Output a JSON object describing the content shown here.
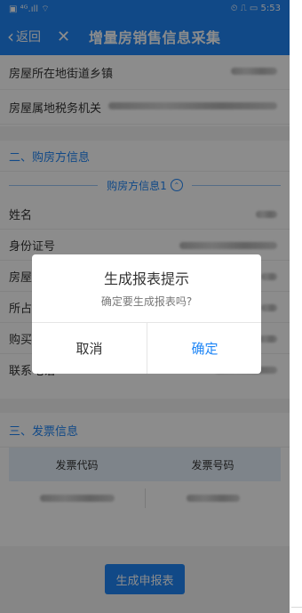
{
  "status_bar": {
    "left": "▣ ⁴ᴳ.ıll ⌔",
    "right": "⏲ ⎍ ▭ 5:53"
  },
  "nav": {
    "back_label": "返回",
    "close_symbol": "✕",
    "title": "增量房销售信息采集"
  },
  "property_info": {
    "rows": [
      {
        "label": "房屋所在地街道乡镇"
      },
      {
        "label": "房屋属地税务机关"
      }
    ]
  },
  "buyer_section": {
    "title": "二、购房方信息",
    "subheader": "购房方信息1",
    "rows": [
      {
        "label": "姓名"
      },
      {
        "label": "身份证号"
      },
      {
        "label": "房屋"
      },
      {
        "label": "所占"
      },
      {
        "label": "购买"
      },
      {
        "label": "联系电话"
      }
    ]
  },
  "invoice_section": {
    "title": "三、发票信息",
    "headers": [
      "发票代码",
      "发票号码"
    ]
  },
  "actions": {
    "submit_label": "生成申报表"
  },
  "dialog": {
    "title": "生成报表提示",
    "message": "确定要生成报表吗?",
    "cancel_label": "取消",
    "confirm_label": "确定"
  }
}
